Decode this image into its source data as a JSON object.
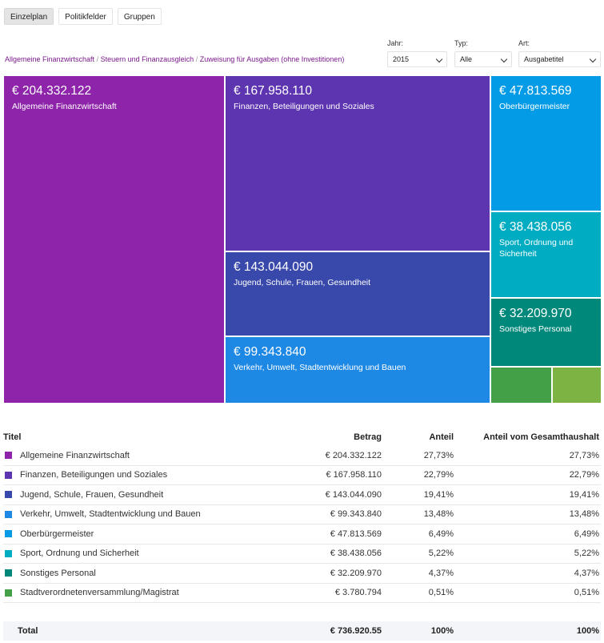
{
  "tabs": [
    "Einzelplan",
    "Politikfelder",
    "Gruppen"
  ],
  "breadcrumb": [
    "Allgemeine Finanzwirtschaft",
    "Steuern und Finanzausgleich",
    "Zuweisung für Ausgaben (ohne Investitionen)"
  ],
  "filters": {
    "jahr": {
      "label": "Jahr:",
      "value": "2015"
    },
    "typ": {
      "label": "Typ:",
      "value": "Alle"
    },
    "art": {
      "label": "Art:",
      "value": "Ausgabetitel"
    }
  },
  "chart_data": {
    "type": "treemap",
    "items": [
      {
        "label": "€ 204.332.122",
        "name": "Allgemeine Finanzwirtschaft",
        "value": 204332122,
        "color": "#8e24aa"
      },
      {
        "label": "€ 167.958.110",
        "name": "Finanzen, Beteiligungen und Soziales",
        "value": 167958110,
        "color": "#5e35b1"
      },
      {
        "label": "€ 143.044.090",
        "name": "Jugend, Schule, Frauen, Gesundheit",
        "value": 143044090,
        "color": "#3949ab"
      },
      {
        "label": "€ 99.343.840",
        "name": "Verkehr, Umwelt, Stadtentwicklung und Bauen",
        "value": 99343840,
        "color": "#1e88e5"
      },
      {
        "label": "€ 47.813.569",
        "name": "Oberbürgermeister",
        "value": 47813569,
        "color": "#039be5"
      },
      {
        "label": "€ 38.438.056",
        "name": "Sport, Ordnung und Sicherheit",
        "value": 38438056,
        "color": "#00acc1"
      },
      {
        "label": "€ 32.209.970",
        "name": "Sonstiges Personal",
        "value": 32209970,
        "color": "#00897b"
      },
      {
        "label": "",
        "name": "",
        "value": 3780794,
        "color": "#43a047"
      },
      {
        "label": "",
        "name": "",
        "value": 3000000,
        "color": "#7cb342"
      }
    ]
  },
  "table": {
    "headers": [
      "Titel",
      "Betrag",
      "Anteil",
      "Anteil vom Gesamthaushalt"
    ],
    "rows": [
      {
        "title": "Allgemeine Finanzwirtschaft",
        "betrag": "€ 204.332.122",
        "anteil": "27,73%",
        "gesamt": "27,73%",
        "color": "#8e24aa"
      },
      {
        "title": "Finanzen, Beteiligungen und Soziales",
        "betrag": "€ 167.958.110",
        "anteil": "22,79%",
        "gesamt": "22,79%",
        "color": "#5e35b1"
      },
      {
        "title": "Jugend, Schule, Frauen, Gesundheit",
        "betrag": "€ 143.044.090",
        "anteil": "19,41%",
        "gesamt": "19,41%",
        "color": "#3949ab"
      },
      {
        "title": "Verkehr, Umwelt, Stadtentwicklung und Bauen",
        "betrag": "€ 99.343.840",
        "anteil": "13,48%",
        "gesamt": "13,48%",
        "color": "#1e88e5"
      },
      {
        "title": "Oberbürgermeister",
        "betrag": "€ 47.813.569",
        "anteil": "6,49%",
        "gesamt": "6,49%",
        "color": "#039be5"
      },
      {
        "title": "Sport, Ordnung und Sicherheit",
        "betrag": "€ 38.438.056",
        "anteil": "5,22%",
        "gesamt": "5,22%",
        "color": "#00acc1"
      },
      {
        "title": "Sonstiges Personal",
        "betrag": "€ 32.209.970",
        "anteil": "4,37%",
        "gesamt": "4,37%",
        "color": "#00897b"
      },
      {
        "title": "Stadtverordnetenversammlung/Magistrat",
        "betrag": "€ 3.780.794",
        "anteil": "0,51%",
        "gesamt": "0,51%",
        "color": "#43a047"
      }
    ],
    "total": {
      "title": "Total",
      "betrag": "€ 736.920.55",
      "anteil": "100%",
      "gesamt": "100%"
    }
  }
}
